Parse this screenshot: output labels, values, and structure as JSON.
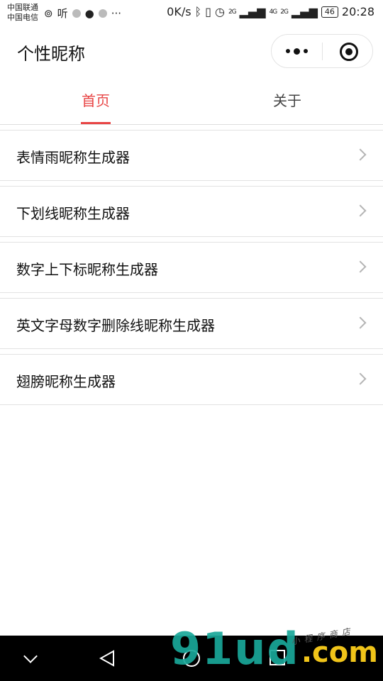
{
  "status_bar": {
    "carrier_1": "中国联通",
    "carrier_2": "中国电信",
    "icon_text": "听",
    "more": "···",
    "speed": "0K/s",
    "network_1": "2G",
    "network_2": "4G",
    "network_3": "2G",
    "battery": "46",
    "time": "20:28"
  },
  "header": {
    "title": "个性昵称"
  },
  "tabs": [
    {
      "label": "首页",
      "active": true
    },
    {
      "label": "关于",
      "active": false
    }
  ],
  "list": {
    "items": [
      {
        "label": "表情雨昵称生成器"
      },
      {
        "label": "下划线昵称生成器"
      },
      {
        "label": "数字上下标昵称生成器"
      },
      {
        "label": "英文字母数字删除线昵称生成器"
      },
      {
        "label": "翅膀昵称生成器"
      }
    ]
  },
  "watermark": {
    "main": "91ud",
    "com": ".com",
    "sub": "小程序商店"
  },
  "colors": {
    "accent": "#e84545",
    "watermark_green": "#1aa89a",
    "watermark_yellow": "#f0c419"
  }
}
